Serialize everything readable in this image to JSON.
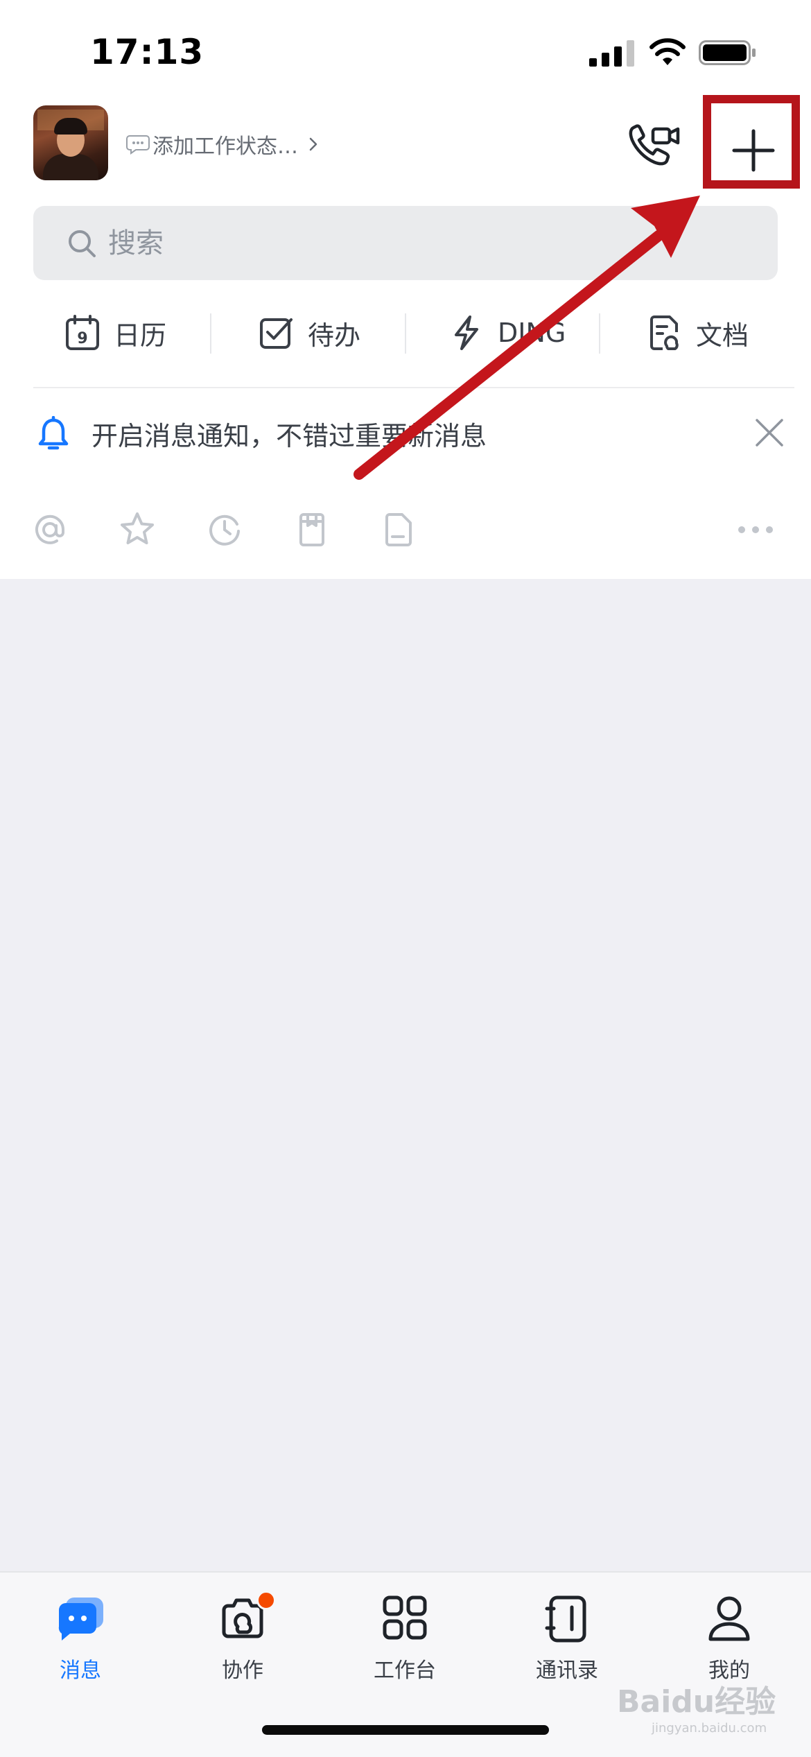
{
  "status_bar": {
    "time": "17:13"
  },
  "header": {
    "work_status": "添加工作状态…",
    "plus_label": "add-menu"
  },
  "search": {
    "placeholder": "搜索"
  },
  "quick_tabs": [
    {
      "label": "日历",
      "icon": "calendar-icon"
    },
    {
      "label": "待办",
      "icon": "checkbox-icon"
    },
    {
      "label": "DING",
      "icon": "lightning-icon"
    },
    {
      "label": "文档",
      "icon": "document-icon"
    }
  ],
  "notification": {
    "text": "开启消息通知，不错过重要新消息"
  },
  "filters": [
    "at-icon",
    "star-icon",
    "clock-icon",
    "bookmark-icon",
    "file-icon",
    "more-icon"
  ],
  "tabbar": {
    "items": [
      {
        "label": "消息",
        "active": true
      },
      {
        "label": "协作",
        "badge": true
      },
      {
        "label": "工作台"
      },
      {
        "label": "通讯录"
      },
      {
        "label": "我的"
      }
    ]
  },
  "watermark": {
    "brand": "Baidu经验",
    "url": "jingyan.baidu.com"
  },
  "colors": {
    "accent": "#1677ff",
    "annotation_red": "#b5151b",
    "badge": "#f54a00"
  }
}
